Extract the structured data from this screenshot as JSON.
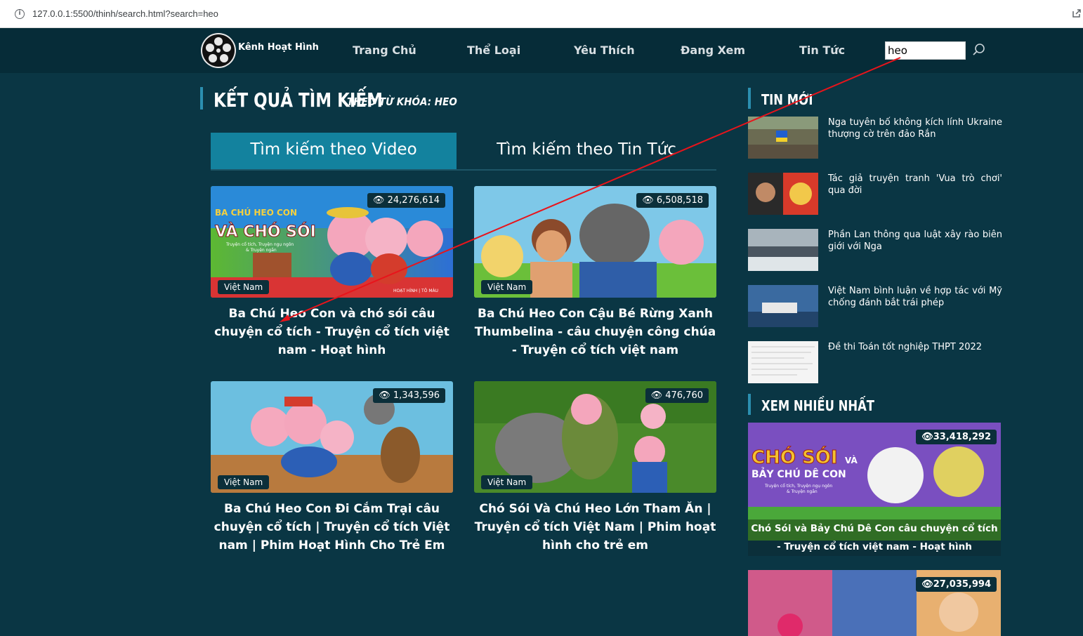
{
  "browser": {
    "url": "127.0.0.1:5500/thinh/search.html?search=heo"
  },
  "header": {
    "logo_text": "Kênh Hoạt Hình",
    "nav": [
      "Trang Chủ",
      "Thể Loại",
      "Yêu Thích",
      "Đang Xem",
      "Tin Tức"
    ],
    "search_value": "heo"
  },
  "results": {
    "title": "KẾT QUẢ TÌM KIẾM",
    "subtitle": "THEO TỪ KHÓA: HEO",
    "tabs": [
      "Tìm kiếm theo Video",
      "Tìm kiếm theo Tin Tức"
    ],
    "videos": [
      {
        "views": "24,276,614",
        "tag": "Việt Nam",
        "title": "Ba Chú Heo Con và chó sói câu chuyện cổ tích - Truyện cổ tích việt nam - Hoạt hình",
        "thumb_text": [
          "BA CHÚ HEO CON",
          "VÀ CHÓ SÓI"
        ],
        "thumb_small": [
          "Truyện cổ tích, Truyện ngụ ngôn",
          "& Truyện ngắn"
        ],
        "thumb_brand": "HOẠT HÌNH | TÔ MÀU"
      },
      {
        "views": "6,508,518",
        "tag": "Việt Nam",
        "title": "Ba Chú Heo Con Cậu Bé Rừng Xanh Thumbelina - câu chuyện công chúa - Truyện cổ tích việt nam"
      },
      {
        "views": "1,343,596",
        "tag": "Việt Nam",
        "title": "Ba Chú Heo Con Đi Cắm Trại câu chuyện cổ tích | Truyện cổ tích Việt nam | Phim Hoạt Hình Cho Trẻ Em"
      },
      {
        "views": "476,760",
        "tag": "Việt Nam",
        "title": "Chó Sói Và Chú Heo Lớn Tham Ăn | Truyện cổ tích Việt Nam | Phim hoạt hình cho trẻ em"
      }
    ]
  },
  "sidebar": {
    "news_title": "TIN MỚI",
    "news": [
      "Nga tuyên bố không kích lính Ukraine thượng cờ trên đảo Rắn",
      "Tác giả truyện tranh 'Vua trò chơi' qua đời",
      "Phần Lan thông qua luật xây rào biên giới với Nga",
      "Việt Nam bình luận về hợp tác với Mỹ chống đánh bắt trái phép",
      "Đề thi Toán tốt nghiệp THPT 2022"
    ],
    "popular_title": "XEM NHIỀU NHẤT",
    "popular": [
      {
        "views": "33,418,292",
        "title": "Chó Sói và Bảy Chú Dê Con câu chuyện cổ tích - Truyện cổ tích việt nam - Hoạt hình",
        "thumb_text": [
          "CHÓ SÓI",
          "VÀ",
          "BẢY CHÚ DÊ CON"
        ],
        "thumb_small": [
          "Truyện cổ tích, Truyện ngụ ngôn",
          "& Truyện ngắn"
        ]
      },
      {
        "views": "27,035,994"
      }
    ]
  },
  "colors": {
    "background": "#0a3644",
    "header": "#062c38",
    "active_tab": "#13829e",
    "accent_bar": "#2b8fb0",
    "annotation_arrow": "#e8141b"
  }
}
